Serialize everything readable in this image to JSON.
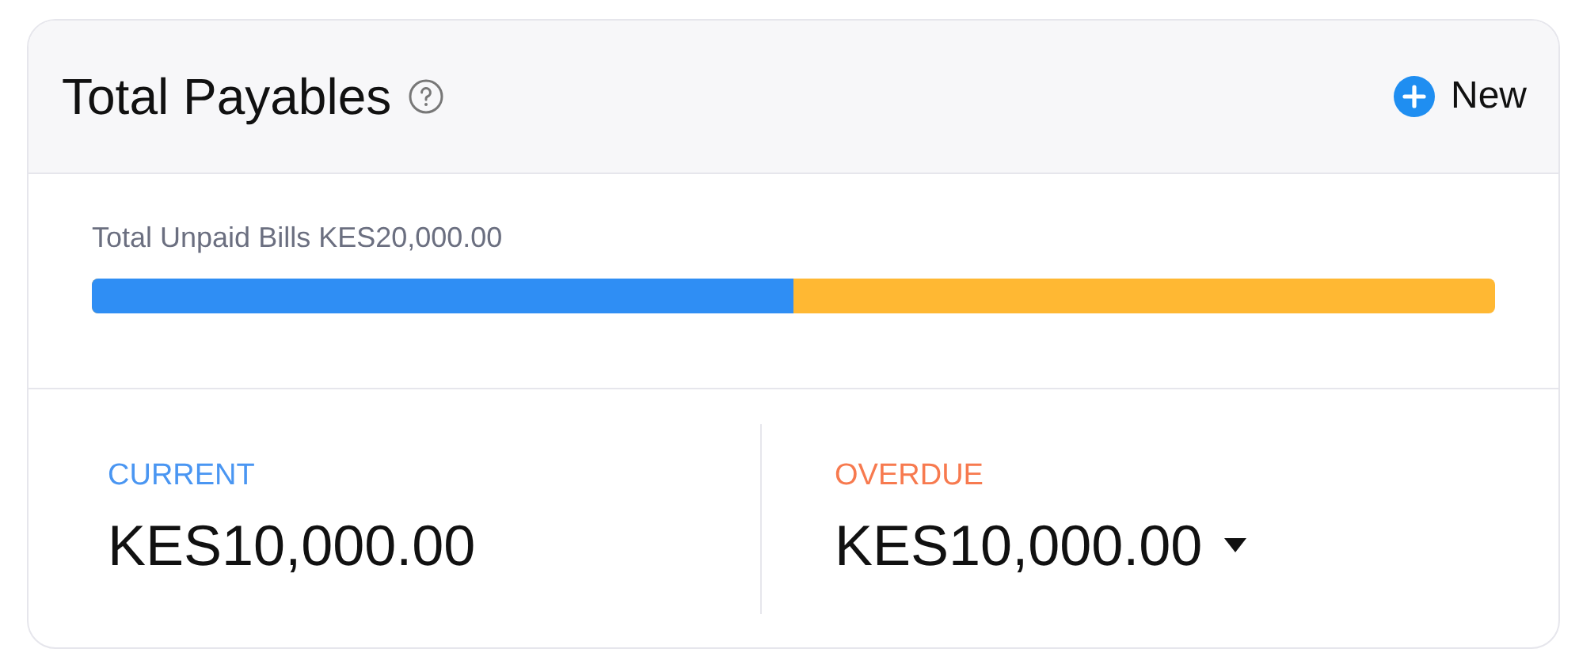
{
  "card": {
    "title": "Total Payables",
    "new_button": {
      "label": "New"
    }
  },
  "unpaid": {
    "label": "Total Unpaid Bills KES20,000.00",
    "level": 0.5
  },
  "summaries": [
    {
      "label": "CURRENT",
      "color": "#4a96f2",
      "amount": "KES10,000.00",
      "dropdown": false
    },
    {
      "label": "OVERDUE",
      "color": "#f77a4f",
      "amount": "KES10,000.00",
      "dropdown": true
    }
  ]
}
